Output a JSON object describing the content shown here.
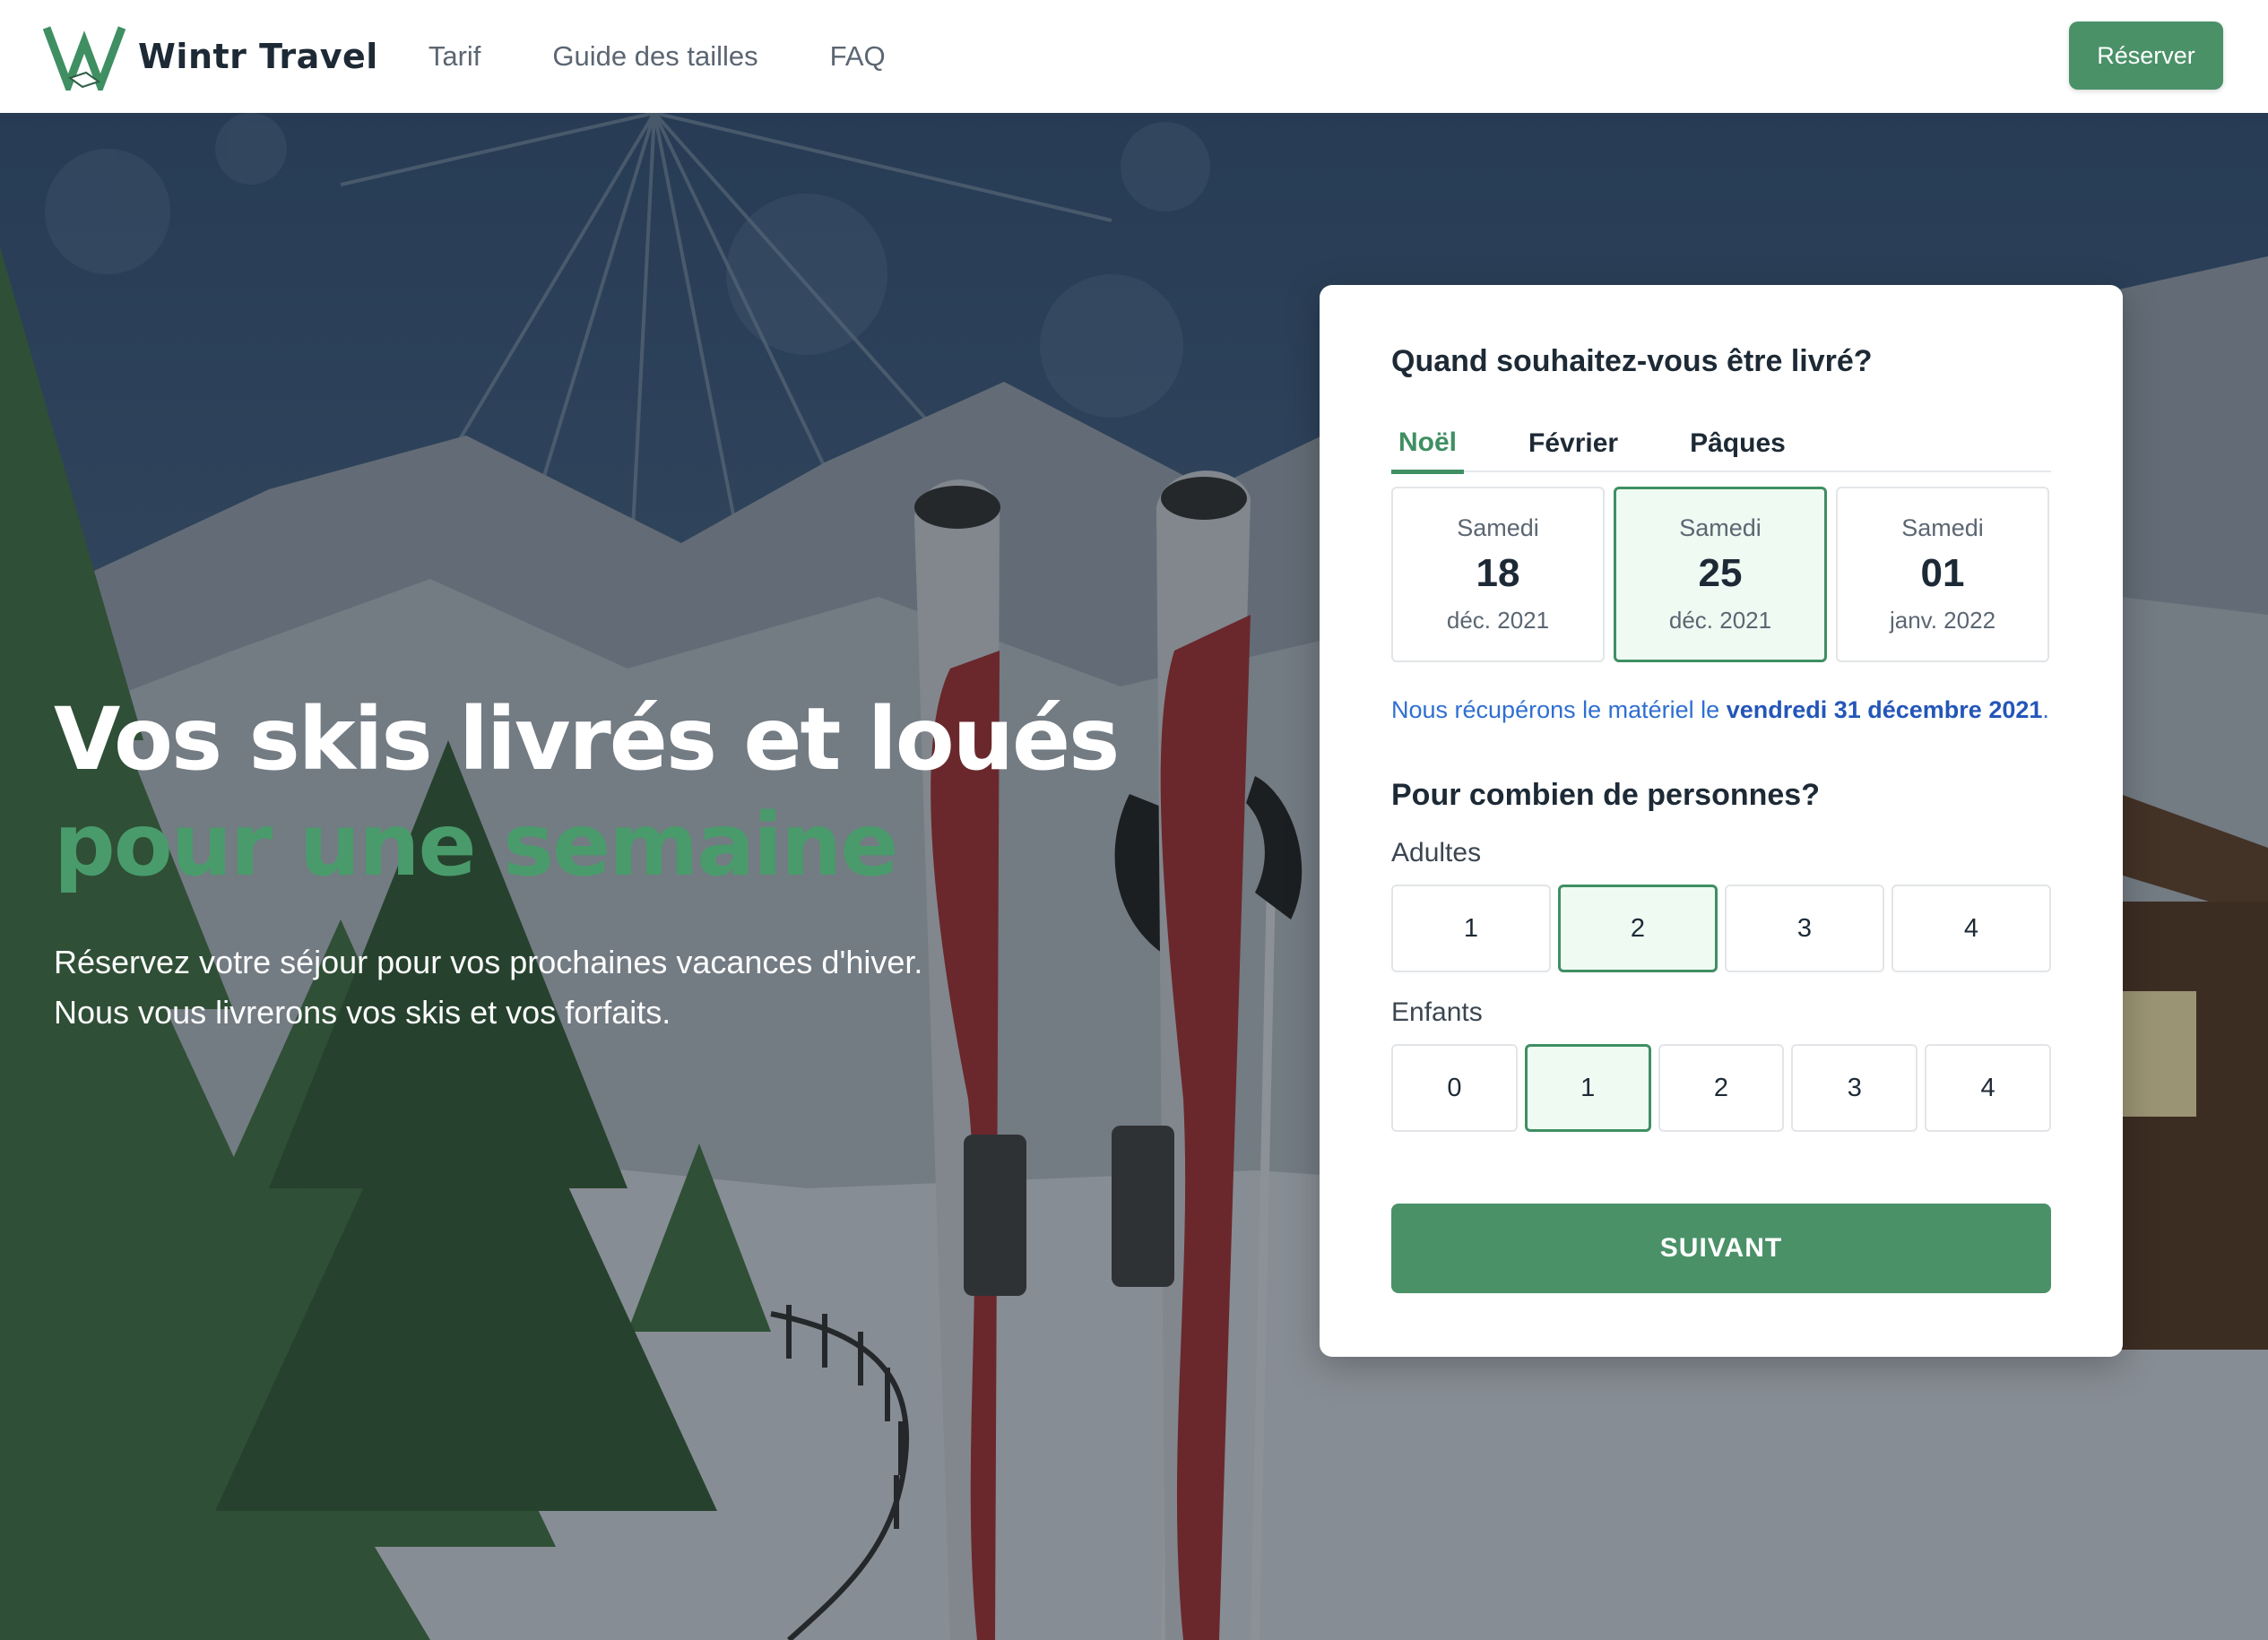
{
  "navbar": {
    "brand": "Wintr Travel",
    "links": [
      "Tarif",
      "Guide des tailles",
      "FAQ"
    ],
    "reserve_label": "Réserver"
  },
  "hero": {
    "title_line1": "Vos skis livrés et loués",
    "title_line2": "pour une semaine",
    "subtitle_line1": "Réservez votre séjour pour vos prochaines vacances d'hiver.",
    "subtitle_line2": "Nous vous livrerons vos skis et vos forfaits."
  },
  "booking": {
    "delivery_question": "Quand souhaitez-vous être livré?",
    "tabs": [
      {
        "label": "Noël",
        "active": true
      },
      {
        "label": "Février",
        "active": false
      },
      {
        "label": "Pâques",
        "active": false
      }
    ],
    "dates": [
      {
        "day": "Samedi",
        "num": "18",
        "month": "déc. 2021",
        "selected": false
      },
      {
        "day": "Samedi",
        "num": "25",
        "month": "déc. 2021",
        "selected": true
      },
      {
        "day": "Samedi",
        "num": "01",
        "month": "janv. 2022",
        "selected": false
      }
    ],
    "pickup_prefix": "Nous récupérons le matériel le ",
    "pickup_date": "vendredi 31 décembre 2021",
    "pickup_suffix": ".",
    "people_question": "Pour combien de personnes?",
    "adults_label": "Adultes",
    "adults_options": [
      "1",
      "2",
      "3",
      "4"
    ],
    "adults_selected": "2",
    "children_label": "Enfants",
    "children_options": [
      "0",
      "1",
      "2",
      "3",
      "4"
    ],
    "children_selected": "1",
    "next_label": "SUIVANT"
  },
  "colors": {
    "brand_green": "#4a9168",
    "accent_green": "#3f8f63",
    "selected_bg": "#eefaf2",
    "link_blue": "#2f6fd1",
    "text_dark": "#1d2a36"
  }
}
